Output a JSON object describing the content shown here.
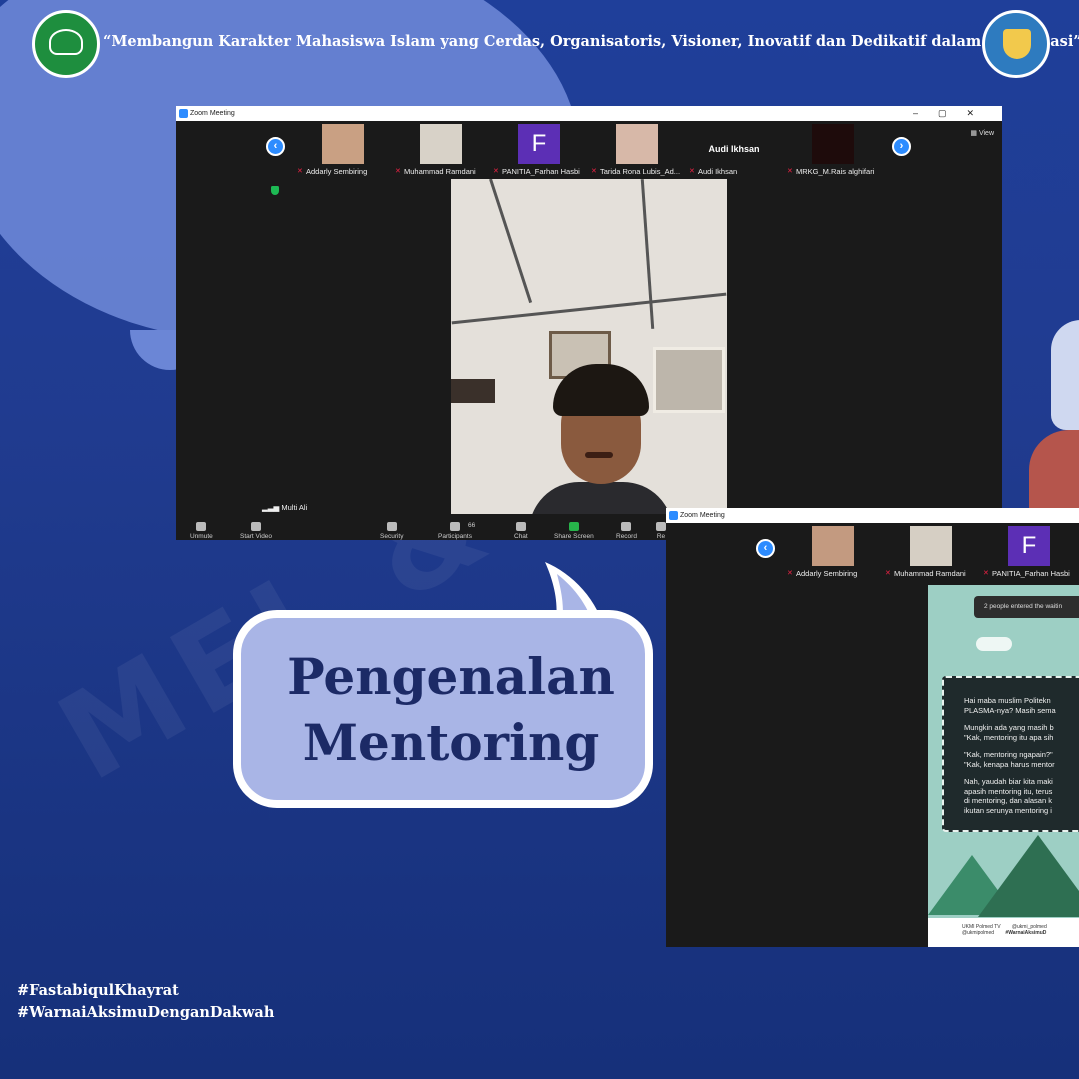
{
  "header": {
    "motto": "“Membangun Karakter Mahasiswa Islam yang Cerdas, Organisatoris, Visioner, Inovatif dan Dedikatif dalam Organisasi”"
  },
  "zoom_main": {
    "title": "Zoom Meeting",
    "view_label": "View",
    "participants": [
      {
        "name": "Addarly Sembiring"
      },
      {
        "name": "Muhammad Ramdani"
      },
      {
        "name": "PANITIA_Farhan Hasbi",
        "initial": "F"
      },
      {
        "name": "Tarida Rona Lubis_Ad..."
      },
      {
        "name": "Audi Ikhsan",
        "display": "Audi Ikhsan"
      },
      {
        "name": "MRKG_M.Rais alghifari"
      }
    ],
    "speaker_label": "Multi Ali",
    "toolbar": {
      "unmute": "Unmute",
      "start_video": "Start Video",
      "security": "Security",
      "participants": "Participants",
      "participants_count": "66",
      "chat": "Chat",
      "share_screen": "Share Screen",
      "record": "Record",
      "reactions": "Re"
    }
  },
  "zoom_second": {
    "title": "Zoom Meeting",
    "participants": [
      {
        "name": "Addarly Sembiring"
      },
      {
        "name": "Muhammad Ramdani"
      },
      {
        "name": "PANITIA_Farhan Hasbi",
        "initial": "F"
      }
    ],
    "notice": "2 people entered the waitin",
    "slide_lines": [
      "Hai maba muslim Politekn",
      "PLASMA-nya? Masih sema",
      "Mungkin ada yang masih b",
      "\"Kak, mentoring itu apa sih",
      "\"Kak, mentoring ngapain?\"",
      "\"Kak, kenapa harus mentor",
      "Nah, yaudah biar kita maki",
      "apasih mentoring itu, terus",
      "di mentoring, dan alasan k",
      "ikutan serunya mentoring i"
    ],
    "footer_items": [
      "UKMI Polmed TV",
      "@ukmi_polmed",
      "@ukmipolmed",
      "#WarnaiAksimuD"
    ]
  },
  "bubble": {
    "line1": "Pengenalan",
    "line2": "Mentoring"
  },
  "hashtags": {
    "tag1": "#FastabiqulKhayrat",
    "tag2": "#WarnaiAksimuDenganDakwah"
  },
  "colors": {
    "background": "#1f3f9a",
    "bubble": "#a9b5e6",
    "bubble_text": "#1c2a66",
    "zoom_blue": "#2d8cff"
  }
}
